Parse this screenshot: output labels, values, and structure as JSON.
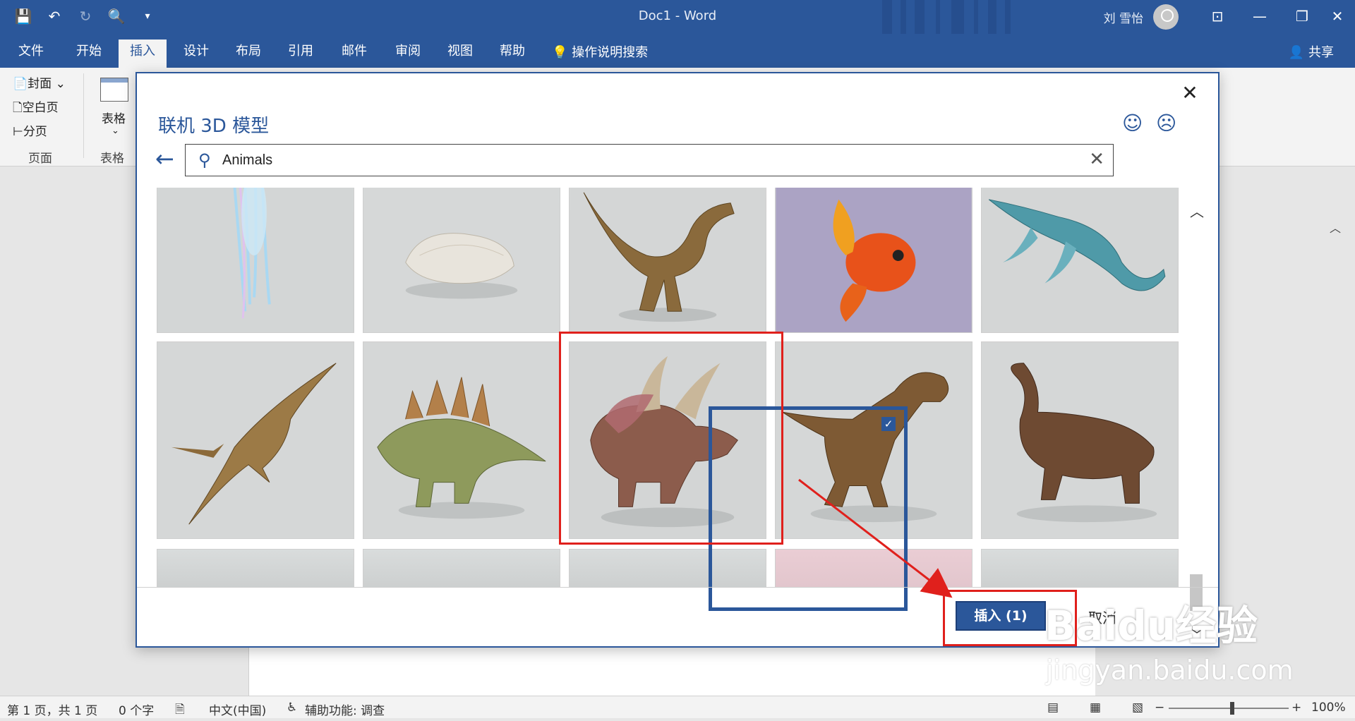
{
  "window": {
    "title": "Doc1  -  Word",
    "user": "刘 雪怡",
    "share": "共享"
  },
  "tabs": [
    "文件",
    "开始",
    "插入",
    "设计",
    "布局",
    "引用",
    "邮件",
    "审阅",
    "视图",
    "帮助"
  ],
  "tell_me": "操作说明搜索",
  "ribbon": {
    "page_items": [
      "封面",
      "空白页",
      "分页"
    ],
    "page_group": "页面",
    "table_label": "表格",
    "table_group": "表格"
  },
  "dialog": {
    "title": "联机 3D 模型",
    "search_value": "Animals",
    "insert_label": "插入 (1)",
    "cancel_label": "取消"
  },
  "grid": {
    "tiles": [
      {
        "name": "jellyfish",
        "row": 1
      },
      {
        "name": "shell",
        "row": 1
      },
      {
        "name": "velociraptor",
        "row": 1
      },
      {
        "name": "goldfish",
        "row": 1
      },
      {
        "name": "plesiosaur",
        "row": 1
      },
      {
        "name": "pterodactyl",
        "row": 2
      },
      {
        "name": "stegosaurus",
        "row": 2
      },
      {
        "name": "triceratops",
        "row": 2,
        "selected": true
      },
      {
        "name": "t-rex",
        "row": 2
      },
      {
        "name": "ankylosaurus",
        "row": 2
      }
    ]
  },
  "status": {
    "page": "第 1 页，共 1 页",
    "words": "0 个字",
    "language": "中文(中国)",
    "accessibility": "辅助功能: 调查",
    "zoom": "100%"
  },
  "watermark": {
    "text": "Baidu经验",
    "url_text": "jingyan.baidu.com"
  }
}
